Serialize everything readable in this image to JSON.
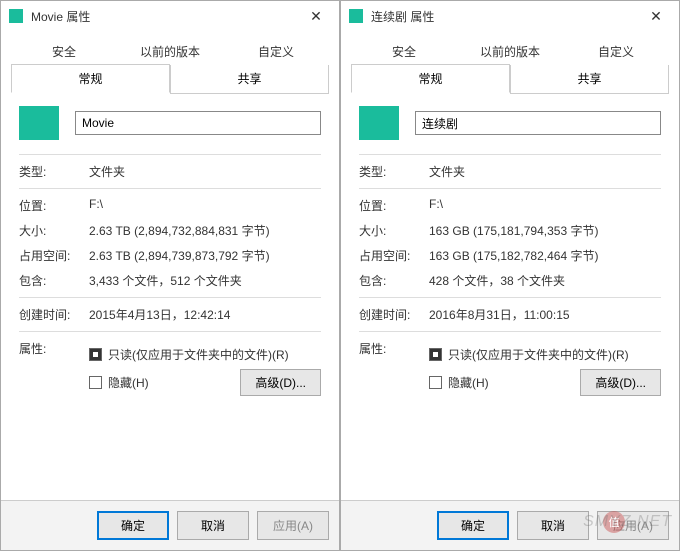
{
  "dialogs": [
    {
      "title": "Movie 属性",
      "tabsTop": [
        "安全",
        "以前的版本",
        "自定义"
      ],
      "tabsBottom": [
        "常规",
        "共享"
      ],
      "activeTab": "常规",
      "folderName": "Movie",
      "type": {
        "label": "类型:",
        "value": "文件夹"
      },
      "location": {
        "label": "位置:",
        "value": "F:\\"
      },
      "size": {
        "label": "大小:",
        "value": "2.63 TB (2,894,732,884,831 字节)"
      },
      "sizeOnDisk": {
        "label": "占用空间:",
        "value": "2.63 TB (2,894,739,873,792 字节)"
      },
      "contains": {
        "label": "包含:",
        "value": "3,433 个文件，512 个文件夹"
      },
      "created": {
        "label": "创建时间:",
        "value": "2015年4月13日，12:42:14"
      },
      "attrLabel": "属性:",
      "readonly": "只读(仅应用于文件夹中的文件)(R)",
      "hidden": "隐藏(H)",
      "advanced": "高级(D)...",
      "ok": "确定",
      "cancel": "取消",
      "apply": "应用(A)"
    },
    {
      "title": "连续剧 属性",
      "tabsTop": [
        "安全",
        "以前的版本",
        "自定义"
      ],
      "tabsBottom": [
        "常规",
        "共享"
      ],
      "activeTab": "常规",
      "folderName": "连续剧",
      "type": {
        "label": "类型:",
        "value": "文件夹"
      },
      "location": {
        "label": "位置:",
        "value": "F:\\"
      },
      "size": {
        "label": "大小:",
        "value": "163 GB (175,181,794,353 字节)"
      },
      "sizeOnDisk": {
        "label": "占用空间:",
        "value": "163 GB (175,182,782,464 字节)"
      },
      "contains": {
        "label": "包含:",
        "value": "428 个文件，38 个文件夹"
      },
      "created": {
        "label": "创建时间:",
        "value": "2016年8月31日，11:00:15"
      },
      "attrLabel": "属性:",
      "readonly": "只读(仅应用于文件夹中的文件)(R)",
      "hidden": "隐藏(H)",
      "advanced": "高级(D)...",
      "ok": "确定",
      "cancel": "取消",
      "apply": "应用(A)"
    }
  ],
  "watermark": "SMYZ.NET",
  "badge": "值"
}
